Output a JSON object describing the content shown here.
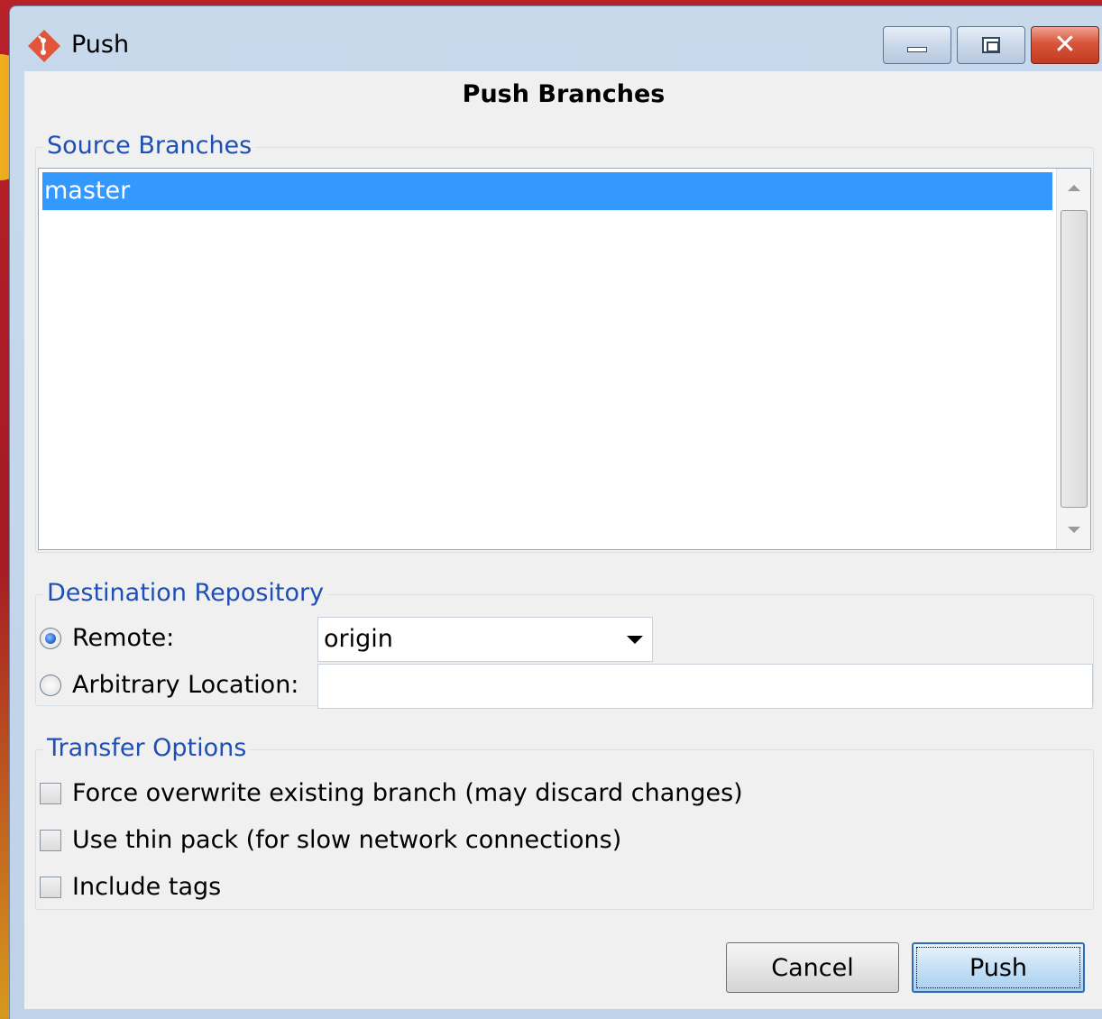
{
  "window": {
    "title": "Push",
    "controls": {
      "minimize": "minimize",
      "maximize": "maximize",
      "close": "close"
    }
  },
  "dialog": {
    "heading": "Push Branches"
  },
  "source_branches": {
    "legend": "Source Branches",
    "items": [
      {
        "label": "master",
        "selected": true
      }
    ]
  },
  "destination": {
    "legend": "Destination Repository",
    "remote": {
      "label": "Remote:",
      "checked": true,
      "value": "origin"
    },
    "arbitrary": {
      "label": "Arbitrary Location:",
      "checked": false,
      "value": ""
    }
  },
  "transfer": {
    "legend": "Transfer Options",
    "options": [
      {
        "label": "Force overwrite existing branch (may discard changes)",
        "checked": false
      },
      {
        "label": "Use thin pack (for slow network connections)",
        "checked": false
      },
      {
        "label": "Include tags",
        "checked": false
      }
    ]
  },
  "buttons": {
    "cancel": "Cancel",
    "push": "Push"
  },
  "colors": {
    "selection": "#3399ff",
    "legend_text": "#1e4fb4",
    "close_button": "#c43a22",
    "app_icon": "#e2553b"
  }
}
